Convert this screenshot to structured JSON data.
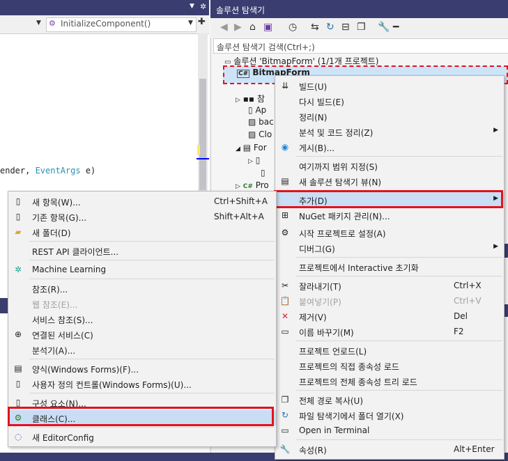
{
  "editor": {
    "method_combo": "InitializeComponent()",
    "code_line_prefix": "ender, ",
    "code_line_type": "EventArgs",
    "code_line_suffix": " e)"
  },
  "solution_explorer": {
    "title": "솔루션 탐색기",
    "search_placeholder": "솔루션 탐색기 검색(Ctrl+;)",
    "tree": {
      "solution": "솔루션 'BitmapForm' (1/1개 프로젝트)",
      "project": "BitmapForm",
      "items": [
        "참",
        "Ap",
        "bac",
        "Clo",
        "For",
        "Pro"
      ]
    }
  },
  "project_menu": {
    "items": [
      {
        "label": "빌드(U)",
        "icon": "build-icon"
      },
      {
        "label": "다시 빌드(E)"
      },
      {
        "label": "정리(N)"
      },
      {
        "label": "분석 및 코드 정리(Z)",
        "submenu": true
      },
      {
        "label": "게시(B)...",
        "icon": "globe-icon"
      },
      {
        "label": "여기까지 범위 지정(S)"
      },
      {
        "label": "새 솔루션 탐색기 뷰(N)",
        "icon": "new-view-icon"
      },
      {
        "label": "추가(D)",
        "submenu": true,
        "highlighted": true
      },
      {
        "label": "NuGet 패키지 관리(N)...",
        "icon": "nuget-icon"
      },
      {
        "label": "시작 프로젝트로 설정(A)",
        "icon": "gear-icon"
      },
      {
        "label": "디버그(G)",
        "submenu": true
      },
      {
        "label": "프로젝트에서 Interactive 초기화"
      },
      {
        "label": "잘라내기(T)",
        "shortcut": "Ctrl+X",
        "icon": "cut-icon"
      },
      {
        "label": "붙여넣기(P)",
        "shortcut": "Ctrl+V",
        "icon": "paste-icon",
        "disabled": true
      },
      {
        "label": "제거(V)",
        "shortcut": "Del",
        "icon": "delete-icon"
      },
      {
        "label": "이름 바꾸기(M)",
        "shortcut": "F2",
        "icon": "rename-icon"
      },
      {
        "label": "프로젝트 언로드(L)"
      },
      {
        "label": "프로젝트의 직접 종속성 로드"
      },
      {
        "label": "프로젝트의 전체 종속성 트리 로드"
      },
      {
        "label": "전체 경로 복사(U)",
        "icon": "copy-icon"
      },
      {
        "label": "파일 탐색기에서 폴더 열기(X)",
        "icon": "refresh-folder-icon"
      },
      {
        "label": "Open in Terminal",
        "icon": "terminal-icon"
      },
      {
        "label": "속성(R)",
        "shortcut": "Alt+Enter",
        "icon": "wrench-icon"
      }
    ]
  },
  "add_menu": {
    "items": [
      {
        "label": "새 항목(W)...",
        "shortcut": "Ctrl+Shift+A",
        "icon": "new-item-icon"
      },
      {
        "label": "기존 항목(G)...",
        "shortcut": "Shift+Alt+A",
        "icon": "existing-item-icon"
      },
      {
        "label": "새 폴더(D)",
        "icon": "folder-icon"
      },
      {
        "label": "REST API 클라이언트..."
      },
      {
        "label": "Machine Learning",
        "icon": "ml-icon"
      },
      {
        "label": "참조(R)..."
      },
      {
        "label": "웹 참조(E)...",
        "disabled": true
      },
      {
        "label": "서비스 참조(S)..."
      },
      {
        "label": "연결된 서비스(C)",
        "icon": "connected-service-icon"
      },
      {
        "label": "분석기(A)..."
      },
      {
        "label": "양식(Windows Forms)(F)...",
        "icon": "form-icon"
      },
      {
        "label": "사용자 정의 컨트롤(Windows Forms)(U)...",
        "icon": "user-control-icon"
      },
      {
        "label": "구성 요소(N)...",
        "icon": "component-icon"
      },
      {
        "label": "클래스(C)...",
        "icon": "class-icon",
        "highlighted": true
      },
      {
        "label": "새 EditorConfig",
        "icon": "lightbulb-icon"
      }
    ]
  }
}
